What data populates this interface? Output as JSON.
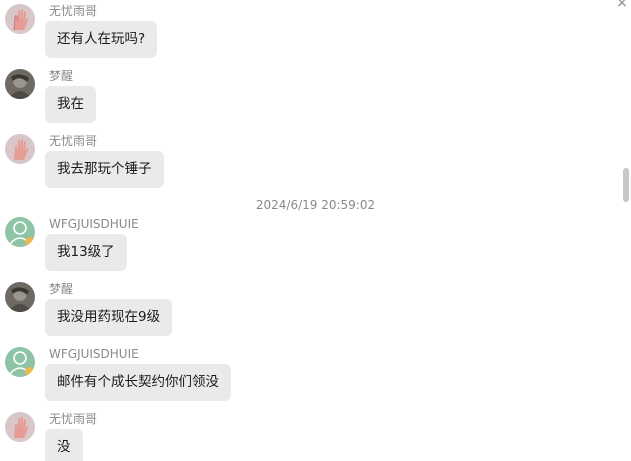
{
  "window": {
    "close_glyph": "×"
  },
  "timestamp": "2024/6/19 20:59:02",
  "messages": [
    {
      "sender": "无忧雨哥",
      "avatar": "hand-avatar-icon",
      "text": "还有人在玩吗?"
    },
    {
      "sender": "梦醒",
      "avatar": "photo-avatar-icon",
      "text": "我在"
    },
    {
      "sender": "无忧雨哥",
      "avatar": "hand-avatar-icon",
      "text": "我去那玩个锤子"
    },
    {
      "sender": "WFGJUISDHUIE",
      "avatar": "default-green-avatar-icon",
      "text": "我13级了"
    },
    {
      "sender": "梦醒",
      "avatar": "photo-avatar-icon",
      "text": "我没用药现在9级"
    },
    {
      "sender": "WFGJUISDHUIE",
      "avatar": "default-green-avatar-icon",
      "text": "邮件有个成长契约你们领没"
    },
    {
      "sender": "无忧雨哥",
      "avatar": "hand-avatar-icon",
      "text": "没"
    }
  ],
  "colors": {
    "bubble_bg": "#eaeaea",
    "name_text": "#8a8a8a",
    "green_avatar": "#7fb99a"
  }
}
